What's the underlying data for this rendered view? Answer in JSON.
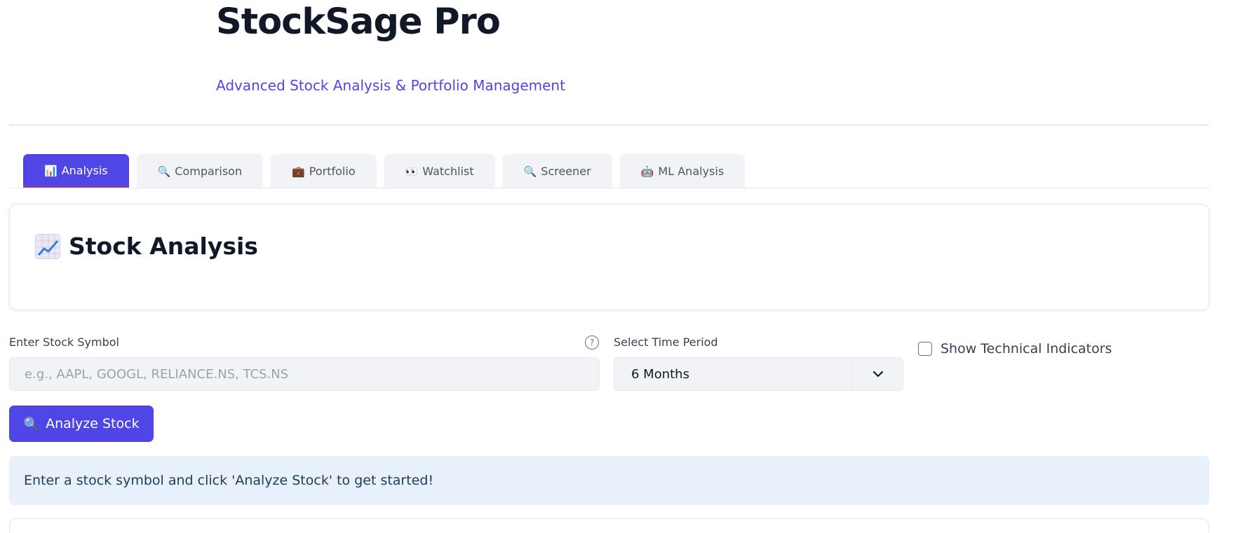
{
  "header": {
    "title": "StockSage Pro",
    "subtitle": "Advanced Stock Analysis & Portfolio Management"
  },
  "tabs": [
    {
      "icon": "📊",
      "label": "Analysis",
      "active": true
    },
    {
      "icon": "🔍",
      "label": "Comparison",
      "active": false
    },
    {
      "icon": "💼",
      "label": "Portfolio",
      "active": false
    },
    {
      "icon": "👀",
      "label": "Watchlist",
      "active": false
    },
    {
      "icon": "🔍",
      "label": "Screener",
      "active": false
    },
    {
      "icon": "🤖",
      "label": "ML Analysis",
      "active": false
    }
  ],
  "section": {
    "icon": "chart-increasing-icon",
    "title": "Stock Analysis"
  },
  "symbol": {
    "label": "Enter Stock Symbol",
    "help": "?",
    "placeholder": "e.g., AAPL, GOOGL, RELIANCE.NS, TCS.NS",
    "value": ""
  },
  "period": {
    "label": "Select Time Period",
    "value": "6 Months"
  },
  "indicators": {
    "label": "Show Technical Indicators",
    "checked": false
  },
  "analyze_button": {
    "icon": "🔍",
    "label": "Analyze Stock"
  },
  "info": {
    "message": "Enter a stock symbol and click 'Analyze Stock' to get started!"
  },
  "colors": {
    "primary": "#4f46e5",
    "active_tab_underline": "#ef4444",
    "info_background": "#e8f1fb"
  }
}
